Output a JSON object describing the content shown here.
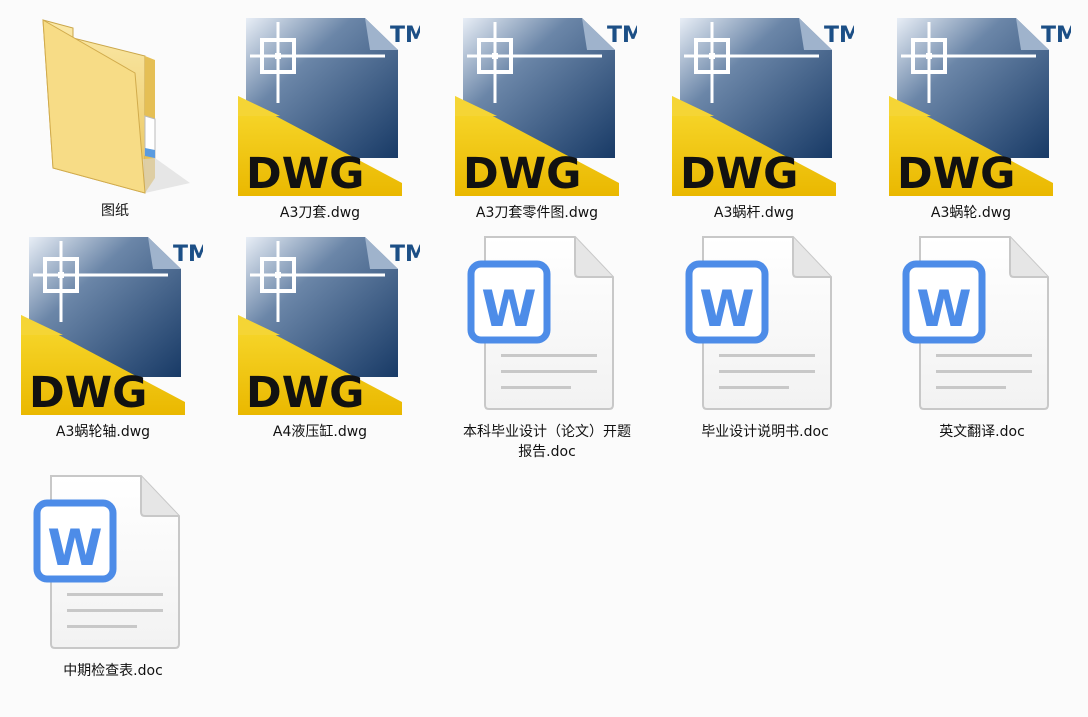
{
  "window": {
    "view": "large-icons"
  },
  "files": [
    {
      "name": "图纸",
      "type": "folder",
      "icon": "folder-icon"
    },
    {
      "name": "A3刀套.dwg",
      "type": "dwg",
      "icon": "dwg-file-icon"
    },
    {
      "name": "A3刀套零件图.dwg",
      "type": "dwg",
      "icon": "dwg-file-icon"
    },
    {
      "name": "A3蜗杆.dwg",
      "type": "dwg",
      "icon": "dwg-file-icon"
    },
    {
      "name": "A3蜗轮.dwg",
      "type": "dwg",
      "icon": "dwg-file-icon"
    },
    {
      "name": "A3蜗轮轴.dwg",
      "type": "dwg",
      "icon": "dwg-file-icon"
    },
    {
      "name": "A4液压缸.dwg",
      "type": "dwg",
      "icon": "dwg-file-icon"
    },
    {
      "name": "本科毕业设计（论文）开题报告.doc",
      "line1": "本科毕业设计（论文）开题",
      "line2": "报告.doc",
      "type": "doc",
      "icon": "word-doc-icon"
    },
    {
      "name": "毕业设计说明书.doc",
      "type": "doc",
      "icon": "word-doc-icon"
    },
    {
      "name": "英文翻译.doc",
      "type": "doc",
      "icon": "word-doc-icon"
    },
    {
      "name": "中期检查表.doc",
      "type": "doc",
      "icon": "word-doc-icon"
    }
  ],
  "icon_text": {
    "dwg_badge": "DWG",
    "tm_mark": "TM",
    "word_letter": "W"
  },
  "colors": {
    "dwg_yellow": "#f4c800",
    "dwg_blue": "#1c4f86",
    "word_blue": "#4d8ce8",
    "folder": "#f3d47a"
  }
}
